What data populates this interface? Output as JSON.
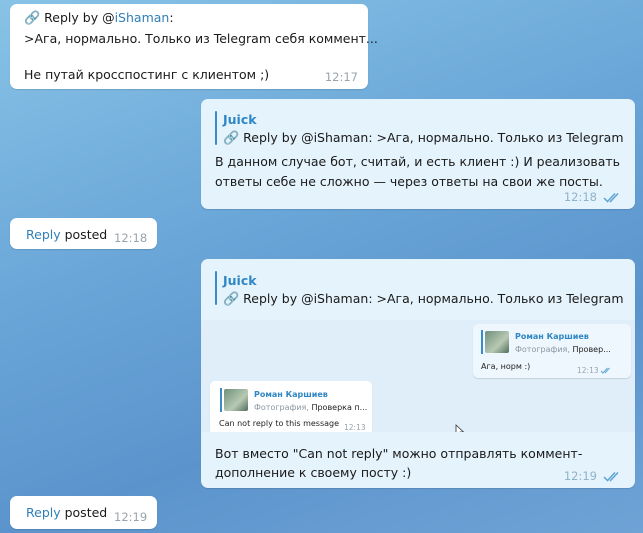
{
  "messages": {
    "m1": {
      "reply_prefix": "Reply by @",
      "reply_handle": "iShaman",
      "reply_suffix": ":",
      "line2": ">Ага, нормально. Только из Telegram себя коммент...",
      "line3": "Не путай кросспостинг с клиентом ;)",
      "time": "12:17"
    },
    "m2": {
      "quote_name": "Juick",
      "quote_text": "Reply by @iShaman: >Ага, нормально. Только из Telegram ",
      "line1": "В данном случае бот, считай, и есть клиент :) И реализовать",
      "line2": "ответы себе не сложно — через ответы на свои же посты.",
      "time": "12:18"
    },
    "m3": {
      "link": "Reply",
      "text": " posted",
      "time": "12:18"
    },
    "m4": {
      "quote_name": "Juick",
      "quote_text": "Reply by @iShaman: >Ага, нормально. Только из Telegram ",
      "screenshot": {
        "right_bubble": {
          "name": "Роман Каршиев",
          "desc_gray": "Фотография,",
          "desc_text": " Провер...",
          "text": "Ага, норм :)",
          "time": "12:13"
        },
        "left_bubble": {
          "name": "Роман Каршиев",
          "desc_gray": "Фотография,",
          "desc_text": " Проверка п...",
          "text": "Can not reply to this message",
          "time": "12:13"
        }
      },
      "line1": "Вот вместо \"Can not reply\" можно отправлять коммент-",
      "line2": "дополнение к своему посту :)",
      "time": "12:19"
    },
    "m5": {
      "link": "Reply",
      "text": " posted",
      "time": "12:19"
    }
  },
  "icons": {
    "link": "link-icon",
    "read": "double-check-icon"
  },
  "colors": {
    "accent": "#2f86c4",
    "outgoing_bg": "#e5f3fc",
    "incoming_bg": "#ffffff"
  }
}
